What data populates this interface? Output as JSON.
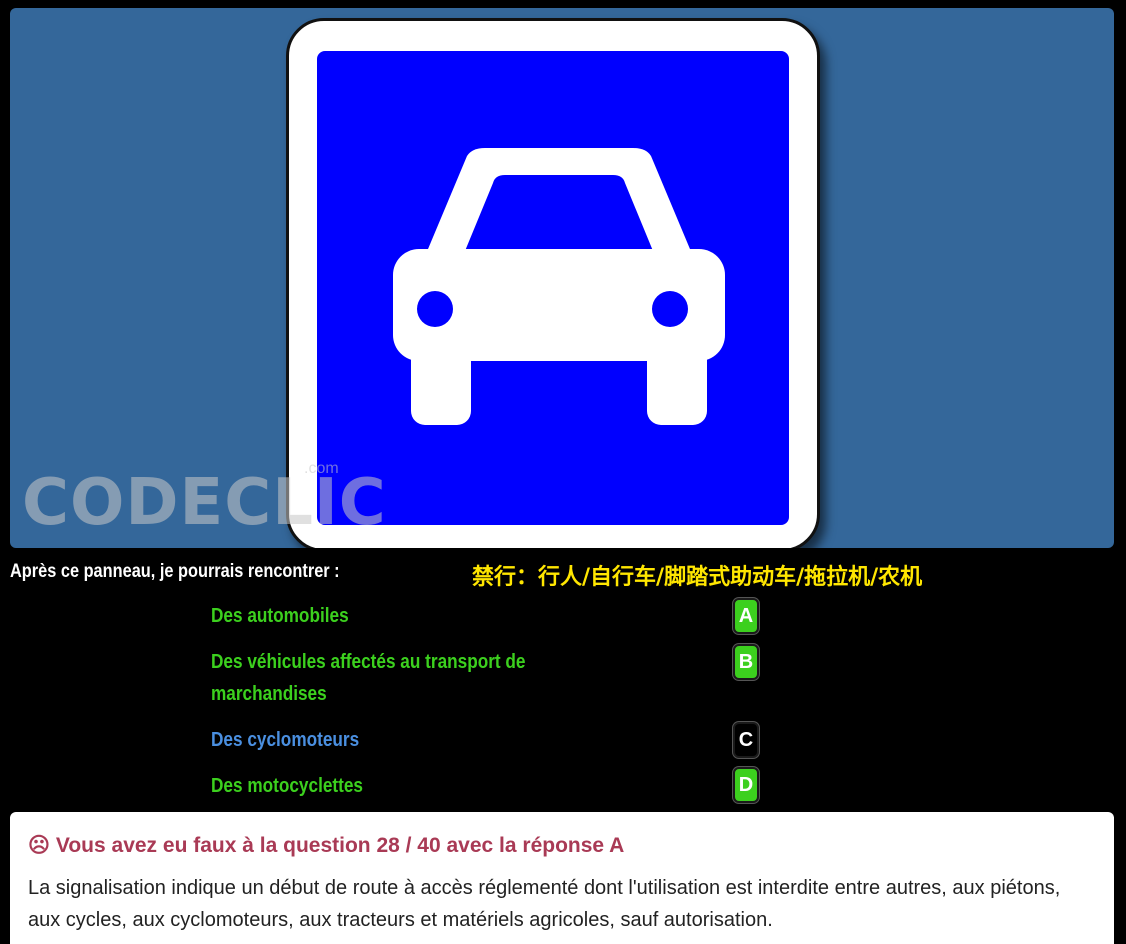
{
  "image": {
    "sign_name": "car-sign",
    "sign_colors": {
      "blue": "#0000ff",
      "panel": "#34679a",
      "border": "#ffffff"
    },
    "watermark_text": "CODECLIC",
    "watermark_suffix": ".com"
  },
  "question": {
    "text": "Après ce panneau, je pourrais rencontrer :",
    "annotation": "禁行：行人/自行车/脚踏式助动车/拖拉机/农机"
  },
  "answers": [
    {
      "text": "Des automobiles",
      "letter": "A",
      "text_color": "#3cd01e",
      "badge_color": "#3cd01e"
    },
    {
      "text": "Des véhicules affectés au transport de marchandises",
      "letter": "B",
      "text_color": "#3cd01e",
      "badge_color": "#3cd01e"
    },
    {
      "text": "Des cyclomoteurs",
      "letter": "C",
      "text_color": "#4a8fe0",
      "badge_color": "#000000"
    },
    {
      "text": "Des motocyclettes",
      "letter": "D",
      "text_color": "#3cd01e",
      "badge_color": "#3cd01e"
    }
  ],
  "feedback": {
    "icon": "frown-icon",
    "icon_glyph": "☹",
    "title": "Vous avez eu faux à la question 28 / 40 avec la réponse A",
    "body": "La signalisation indique un début de route à accès réglementé dont l'utilisation est interdite entre autres, aux piétons, aux cycles, aux cyclomoteurs, aux tracteurs et matériels agricoles, sauf autorisation."
  }
}
